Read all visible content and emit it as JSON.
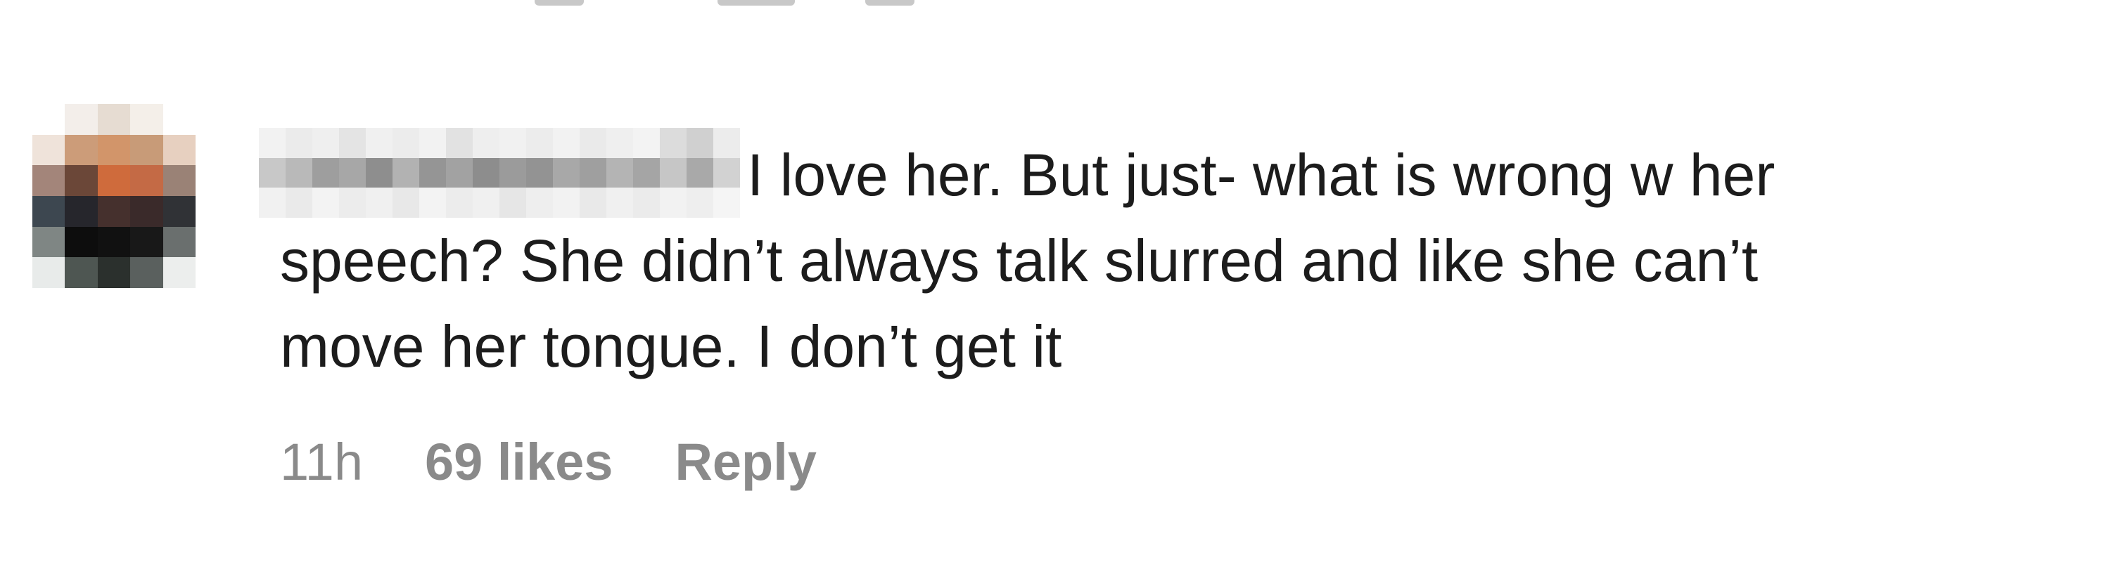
{
  "comment": {
    "username": "",
    "body_line1": "I love her. But just- what is wrong w her",
    "body_line2": "speech? She didn’t always talk slurred and like she can’t",
    "body_line3": "move her tongue. I don’t get it",
    "timestamp": "11h",
    "likes_label": "69 likes",
    "reply_label": "Reply"
  },
  "avatar": {
    "icon": "blurred-profile-avatar",
    "pixels": [
      "#ffffff",
      "#f3eeea",
      "#e6dcd2",
      "#f4efe9",
      "#ffffff",
      "#efe3da",
      "#cc9c79",
      "#d2956a",
      "#c89b78",
      "#e7d0c0",
      "#a3857a",
      "#6b4738",
      "#cf6b3c",
      "#c46a45",
      "#9a8276",
      "#3d4750",
      "#26262c",
      "#45302d",
      "#3a2a2a",
      "#303236",
      "#7f8684",
      "#0d0d0d",
      "#111111",
      "#181818",
      "#6a6f6e",
      "#e8ebea",
      "#4e5652",
      "#2b302d",
      "#5a605e",
      "#eceeed"
    ]
  },
  "username_blur": {
    "pixels": [
      "#f2f2f2",
      "#ebebeb",
      "#efefef",
      "#e4e4e4",
      "#f0f0f0",
      "#ececec",
      "#f2f2f2",
      "#e2e2e2",
      "#eeeeee",
      "#f1f1f1",
      "#ececec",
      "#f2f2f2",
      "#eaeaea",
      "#efefef",
      "#f3f3f3",
      "#dcdcdc",
      "#d0d0d0",
      "#ececec",
      "#c8c8c8",
      "#b9b9b9",
      "#9e9e9e",
      "#a7a7a7",
      "#8e8e8e",
      "#b2b2b2",
      "#959595",
      "#a2a2a2",
      "#8d8d8d",
      "#9b9b9b",
      "#939393",
      "#a8a8a8",
      "#9f9f9f",
      "#b4b4b4",
      "#a5a5a5",
      "#c6c6c6",
      "#a9a9a9",
      "#d2d2d2",
      "#f1f1f1",
      "#eaeaea",
      "#f3f3f3",
      "#ececec",
      "#f0f0f0",
      "#e8e8e8",
      "#f3f3f3",
      "#ececec",
      "#f0f0f0",
      "#e6e6e6",
      "#eeeeee",
      "#f2f2f2",
      "#e9e9e9",
      "#f0f0f0",
      "#ebebeb",
      "#f2f2f2",
      "#eeeeee",
      "#f5f5f5"
    ]
  }
}
